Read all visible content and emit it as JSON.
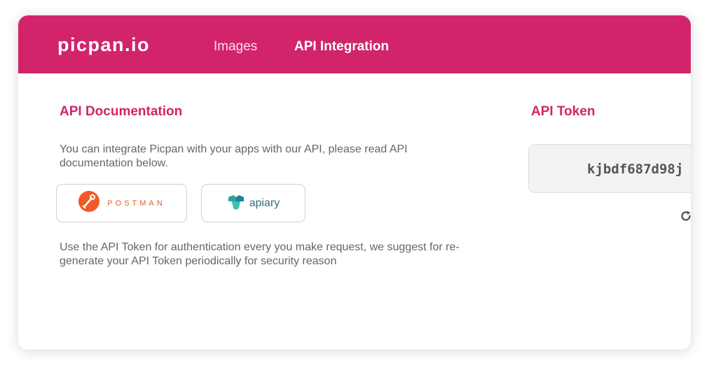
{
  "header": {
    "logo": "picpan.io",
    "nav": [
      {
        "label": "Images"
      },
      {
        "label": "API Integration"
      }
    ],
    "bg_color": "#d2246b"
  },
  "docs": {
    "title": "API Documentation",
    "intro": "You can integrate Picpan with your apps with our API, please read API documentation below.",
    "buttons": [
      {
        "label": "POSTMAN",
        "icon": "postman-icon"
      },
      {
        "label": "apiary",
        "icon": "apiary-icon"
      }
    ],
    "note": "Use the API Token for authentication every you make request, we suggest for re-generate your API Token periodically for security reason"
  },
  "token": {
    "title": "API Token",
    "value": "kjbdf687d98j",
    "refresh_icon": "refresh-icon"
  },
  "colors": {
    "accent": "#d2246b",
    "postman": "#ef5b25",
    "apiary": "#3d6b82"
  }
}
